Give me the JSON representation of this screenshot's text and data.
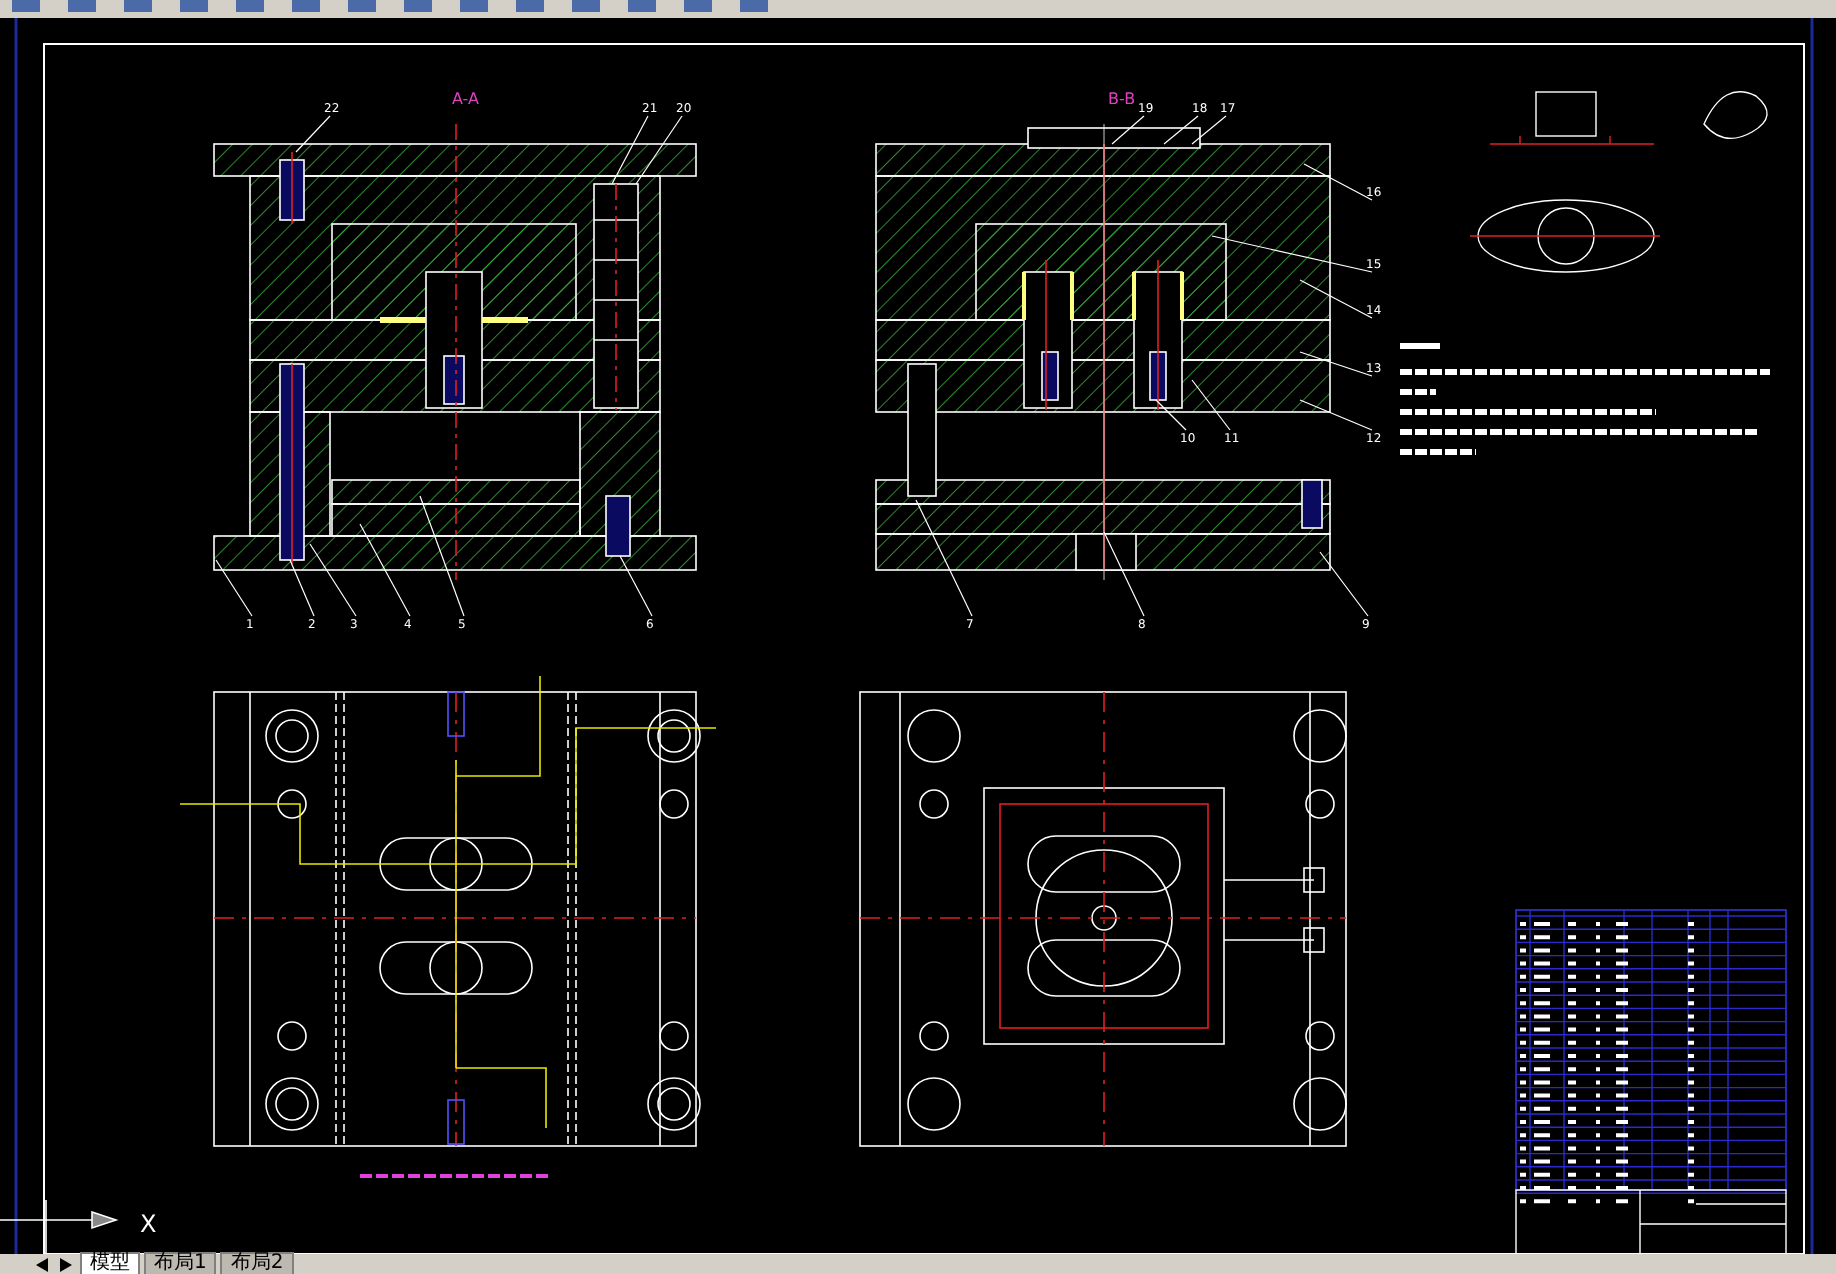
{
  "drawing": {
    "views": [
      {
        "title": "A-A"
      },
      {
        "title": "B-B"
      }
    ],
    "part_labels": [
      "22",
      "21",
      "20",
      "1",
      "2",
      "3",
      "4",
      "5",
      "6",
      "19",
      "18",
      "17",
      "16",
      "15",
      "14",
      "13",
      "10",
      "11",
      "12",
      "7",
      "8",
      "9"
    ],
    "ucs_axis_label": "X"
  },
  "layout_tabs": [
    {
      "label": "模型",
      "selected": true
    },
    {
      "label": "布局1",
      "selected": false
    },
    {
      "label": "布局2",
      "selected": false
    }
  ]
}
